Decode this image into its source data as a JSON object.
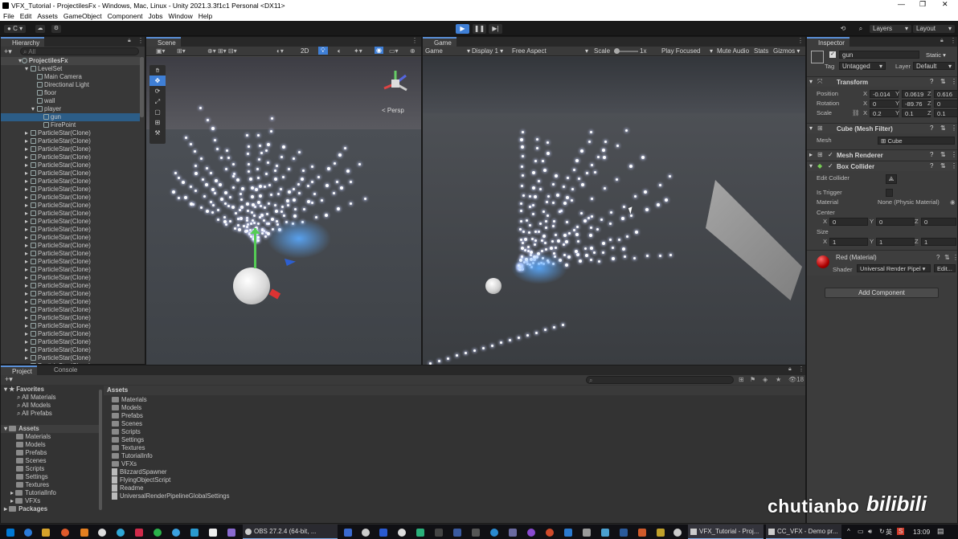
{
  "window": {
    "title": "VFX_Tutorial - ProjectilesFx - Windows, Mac, Linux - Unity 2021.3.3f1c1 Personal <DX11>"
  },
  "menu": [
    "File",
    "Edit",
    "Assets",
    "GameObject",
    "Component",
    "Jobs",
    "Window",
    "Help"
  ],
  "toolbar": {
    "account": "C",
    "layers": "Layers",
    "layout": "Layout"
  },
  "hierarchy": {
    "tab": "Hierarchy",
    "search_placeholder": "All",
    "scene": "ProjectilesFx",
    "items": [
      {
        "label": "LevelSet",
        "indent": 1
      },
      {
        "label": "Main Camera",
        "indent": 2
      },
      {
        "label": "Directional Light",
        "indent": 2
      },
      {
        "label": "floor",
        "indent": 2
      },
      {
        "label": "wall",
        "indent": 2
      },
      {
        "label": "player",
        "indent": 2
      },
      {
        "label": "gun",
        "indent": 3,
        "selected": true
      },
      {
        "label": "FirePoint",
        "indent": 3
      }
    ],
    "clone_label": "ParticleStar(Clone)",
    "clone_count": 30
  },
  "scene_view": {
    "tab": "Scene",
    "btn_2d": "2D",
    "persp": "< Persp"
  },
  "game_view": {
    "tab": "Game",
    "mode": "Game",
    "display": "Display 1",
    "aspect": "Free Aspect",
    "scale_label": "Scale",
    "scale_value": "1x",
    "play_focused": "Play Focused",
    "mute": "Mute Audio",
    "stats": "Stats",
    "gizmos": "Gizmos"
  },
  "inspector": {
    "tab": "Inspector",
    "object_name": "gun",
    "static": "Static",
    "tag_label": "Tag",
    "tag": "Untagged",
    "layer_label": "Layer",
    "layer": "Default",
    "transform": {
      "title": "Transform",
      "position_label": "Position",
      "rotation_label": "Rotation",
      "scale_label": "Scale",
      "position": {
        "x": "-0.014",
        "y": "0.0619",
        "z": "0.616"
      },
      "rotation": {
        "x": "0",
        "y": "-89.76",
        "z": "0"
      },
      "scale": {
        "x": "0.2",
        "y": "0.1",
        "z": "0.1"
      }
    },
    "mesh_filter": {
      "title": "Cube (Mesh Filter)",
      "mesh_label": "Mesh",
      "mesh": "Cube"
    },
    "mesh_renderer": {
      "title": "Mesh Renderer"
    },
    "box_collider": {
      "title": "Box Collider",
      "edit_label": "Edit Collider",
      "trigger_label": "Is Trigger",
      "material_label": "Material",
      "material": "None (Physic Material)",
      "center_label": "Center",
      "center": {
        "x": "0",
        "y": "0",
        "z": "0"
      },
      "size_label": "Size",
      "size": {
        "x": "1",
        "y": "1",
        "z": "1"
      }
    },
    "material": {
      "title": "Red (Material)",
      "shader_label": "Shader",
      "shader": "Universal Render Pipel",
      "edit": "Edit..."
    },
    "add_component": "Add Component"
  },
  "project": {
    "tab_project": "Project",
    "tab_console": "Console",
    "favorites_label": "Favorites",
    "favorites": [
      "All Materials",
      "All Models",
      "All Prefabs"
    ],
    "assets_label": "Assets",
    "tree": [
      "Materials",
      "Models",
      "Prefabs",
      "Scenes",
      "Scripts",
      "Settings",
      "Textures",
      "TutorialInfo",
      "VFXs"
    ],
    "packages": "Packages",
    "breadcrumb": "Assets",
    "folders": [
      "Materials",
      "Models",
      "Prefabs",
      "Scenes",
      "Scripts",
      "Settings",
      "Textures",
      "TutorialInfo",
      "VFXs"
    ],
    "files": [
      "BlizzardSpawner",
      "FlyingObjectScript",
      "Readme",
      "UniversalRenderPipelineGlobalSettings"
    ],
    "count": "18"
  },
  "watermark": {
    "text": "chutianbo"
  },
  "taskbar": {
    "obs": "OBS 27.2.4 (64-bit, ...",
    "vfx": "VFX_Tutorial - Proj...",
    "cc": "CC_VFX - Demo pr...",
    "ime": "英",
    "time": "13:09"
  },
  "colors": {
    "accent": "#5a8fd6",
    "play_active": "#3f7fd6",
    "selection": "#2c5d87"
  }
}
